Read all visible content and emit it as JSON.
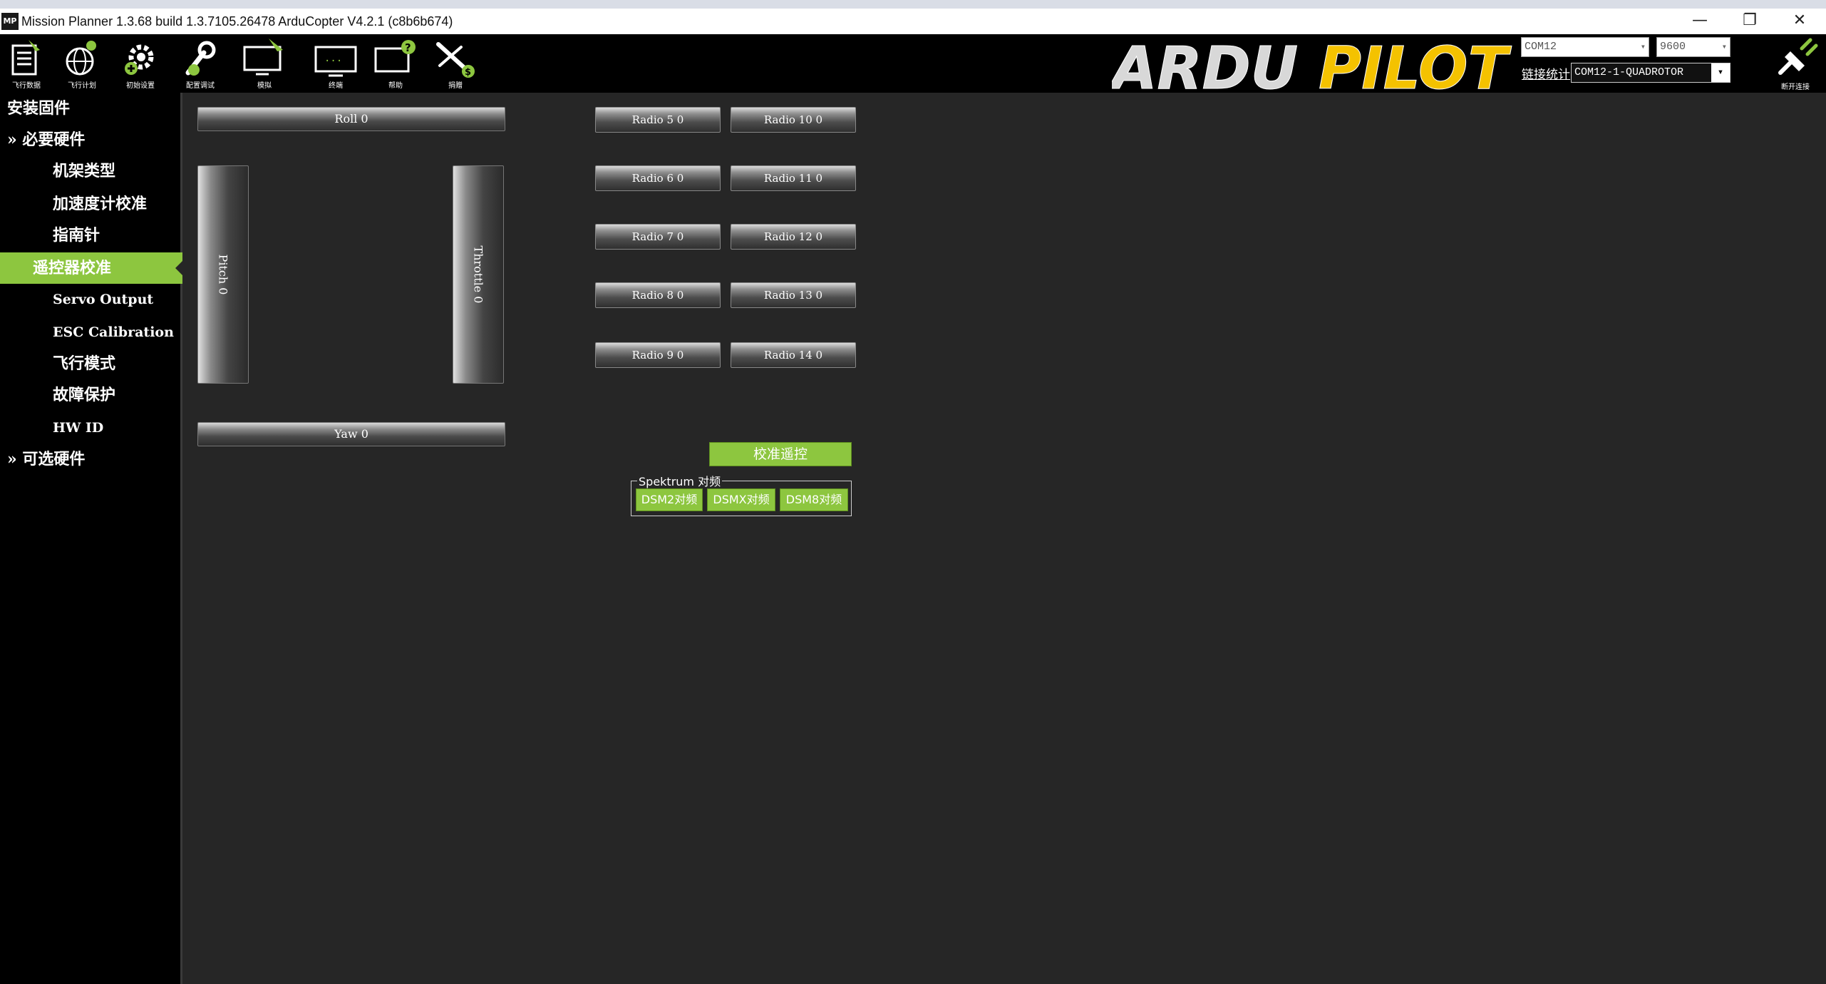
{
  "window": {
    "title": "Mission Planner 1.3.68 build 1.3.7105.26478 ArduCopter V4.2.1 (c8b6b674)",
    "app_icon_text": "MP",
    "minimize": "—",
    "restore": "❐",
    "close": "✕"
  },
  "toolbar": {
    "items": [
      {
        "label": "飞行数据"
      },
      {
        "label": "飞行计划"
      },
      {
        "label": "初始设置"
      },
      {
        "label": "配置调试"
      },
      {
        "label": "模拟"
      },
      {
        "label": "终端"
      },
      {
        "label": "帮助"
      },
      {
        "label": "捐赠"
      }
    ],
    "logo_text_1": "ARDU",
    "logo_text_2": "PILOT",
    "port": "COM12",
    "baud": "9600",
    "link_stats": "链接统计",
    "vehicle": "COM12-1-QUADROTOR",
    "disconnect_label": "断开连接"
  },
  "sidebar": {
    "items": [
      {
        "label": "安装固件"
      },
      {
        "label": "必要硬件"
      },
      {
        "label": "机架类型"
      },
      {
        "label": "加速度计校准"
      },
      {
        "label": "指南针"
      },
      {
        "label": "遥控器校准"
      },
      {
        "label": "Servo Output"
      },
      {
        "label": "ESC Calibration"
      },
      {
        "label": "飞行模式"
      },
      {
        "label": "故障保护"
      },
      {
        "label": "HW ID"
      },
      {
        "label": "可选硬件"
      }
    ],
    "expand_glyph": "»"
  },
  "radio": {
    "roll": "Roll  0",
    "pitch": "Pitch  0",
    "throttle": "Throttle  0",
    "yaw": "Yaw  0",
    "channels": [
      "Radio 5  0",
      "Radio 6  0",
      "Radio 7  0",
      "Radio 8  0",
      "Radio 9  0",
      "Radio 10  0",
      "Radio 11  0",
      "Radio 12  0",
      "Radio 13  0",
      "Radio 14  0"
    ],
    "calibrate": "校准遥控",
    "spektrum_legend": "Spektrum 对频",
    "dsm2": "DSM2对频",
    "dsmx": "DSMX对频",
    "dsm8": "DSM8对频"
  },
  "colors": {
    "accent": "#8dc63f",
    "background": "#262626",
    "sidebar": "#000000"
  }
}
